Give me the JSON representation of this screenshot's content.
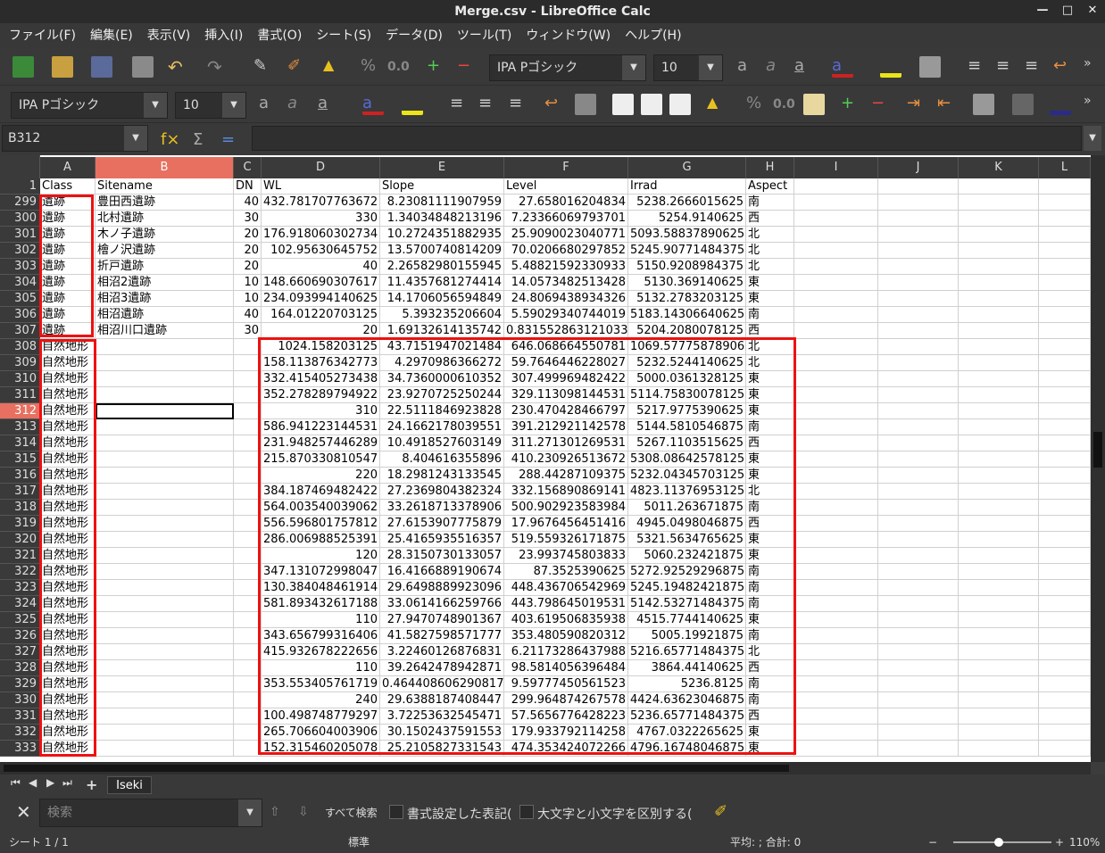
{
  "window": {
    "title": "Merge.csv - LibreOffice Calc"
  },
  "menu": [
    "ファイル(F)",
    "編集(E)",
    "表示(V)",
    "挿入(I)",
    "書式(O)",
    "シート(S)",
    "データ(D)",
    "ツール(T)",
    "ウィンドウ(W)",
    "ヘルプ(H)"
  ],
  "toolbar1": {
    "font_name": "IPA Pゴシック",
    "font_size": "10",
    "num_format": "0.0"
  },
  "toolbar2": {
    "font_name": "IPA Pゴシック",
    "font_size": "10",
    "num_format": "0.0"
  },
  "formula": {
    "cell_ref": "B312",
    "content": ""
  },
  "sheet": {
    "columns": [
      "A",
      "B",
      "C",
      "D",
      "E",
      "F",
      "G",
      "H",
      "I",
      "J",
      "K",
      "L"
    ],
    "header_row": {
      "row": "1",
      "cells": [
        "Class",
        "Sitename",
        "DN",
        "WL",
        "Slope",
        "Level",
        "Irrad",
        "Aspect"
      ]
    },
    "rows": [
      {
        "n": "299",
        "cells": [
          "遺跡",
          "豊田西遺跡",
          "40",
          "432.781707763672",
          "8.23081111907959",
          "27.658016204834",
          "5238.2666015625",
          "南"
        ]
      },
      {
        "n": "300",
        "cells": [
          "遺跡",
          "北村遺跡",
          "30",
          "330",
          "1.34034848213196",
          "7.23366069793701",
          "5254.9140625",
          "西"
        ]
      },
      {
        "n": "301",
        "cells": [
          "遺跡",
          "木ノ子遺跡",
          "20",
          "176.918060302734",
          "10.2724351882935",
          "25.9090023040771",
          "5093.58837890625",
          "北"
        ]
      },
      {
        "n": "302",
        "cells": [
          "遺跡",
          "檜ノ沢遺跡",
          "20",
          "102.95630645752",
          "13.5700740814209",
          "70.0206680297852",
          "5245.90771484375",
          "北"
        ]
      },
      {
        "n": "303",
        "cells": [
          "遺跡",
          "折戸遺跡",
          "20",
          "40",
          "2.26582980155945",
          "5.48821592330933",
          "5150.9208984375",
          "北"
        ]
      },
      {
        "n": "304",
        "cells": [
          "遺跡",
          "相沼2遺跡",
          "10",
          "148.660690307617",
          "11.4357681274414",
          "14.0573482513428",
          "5130.369140625",
          "東"
        ]
      },
      {
        "n": "305",
        "cells": [
          "遺跡",
          "相沼3遺跡",
          "10",
          "234.093994140625",
          "14.1706056594849",
          "24.8069438934326",
          "5132.2783203125",
          "東"
        ]
      },
      {
        "n": "306",
        "cells": [
          "遺跡",
          "相沼遺跡",
          "40",
          "164.01220703125",
          "5.393235206604",
          "5.59029340744019",
          "5183.14306640625",
          "南"
        ]
      },
      {
        "n": "307",
        "cells": [
          "遺跡",
          "相沼川口遺跡",
          "30",
          "20",
          "1.69132614135742",
          "0.831552863121033",
          "5204.2080078125",
          "西"
        ]
      },
      {
        "n": "308",
        "cells": [
          "自然地形",
          "",
          "",
          "1024.158203125",
          "43.7151947021484",
          "646.068664550781",
          "1069.57775878906",
          "北"
        ]
      },
      {
        "n": "309",
        "cells": [
          "自然地形",
          "",
          "",
          "158.113876342773",
          "4.2970986366272",
          "59.7646446228027",
          "5232.5244140625",
          "北"
        ]
      },
      {
        "n": "310",
        "cells": [
          "自然地形",
          "",
          "",
          "332.415405273438",
          "34.7360000610352",
          "307.499969482422",
          "5000.0361328125",
          "東"
        ]
      },
      {
        "n": "311",
        "cells": [
          "自然地形",
          "",
          "",
          "352.278289794922",
          "23.9270725250244",
          "329.113098144531",
          "5114.75830078125",
          "東"
        ]
      },
      {
        "n": "312",
        "cells": [
          "自然地形",
          "",
          "",
          "310",
          "22.5111846923828",
          "230.470428466797",
          "5217.9775390625",
          "東"
        ]
      },
      {
        "n": "313",
        "cells": [
          "自然地形",
          "",
          "",
          "586.941223144531",
          "24.1662178039551",
          "391.212921142578",
          "5144.5810546875",
          "南"
        ]
      },
      {
        "n": "314",
        "cells": [
          "自然地形",
          "",
          "",
          "231.948257446289",
          "10.4918527603149",
          "311.271301269531",
          "5267.1103515625",
          "西"
        ]
      },
      {
        "n": "315",
        "cells": [
          "自然地形",
          "",
          "",
          "215.870330810547",
          "8.404616355896",
          "410.230926513672",
          "5308.08642578125",
          "東"
        ]
      },
      {
        "n": "316",
        "cells": [
          "自然地形",
          "",
          "",
          "220",
          "18.2981243133545",
          "288.44287109375",
          "5232.04345703125",
          "東"
        ]
      },
      {
        "n": "317",
        "cells": [
          "自然地形",
          "",
          "",
          "384.187469482422",
          "27.2369804382324",
          "332.156890869141",
          "4823.11376953125",
          "北"
        ]
      },
      {
        "n": "318",
        "cells": [
          "自然地形",
          "",
          "",
          "564.003540039062",
          "33.2618713378906",
          "500.902923583984",
          "5011.263671875",
          "南"
        ]
      },
      {
        "n": "319",
        "cells": [
          "自然地形",
          "",
          "",
          "556.596801757812",
          "27.6153907775879",
          "17.9676456451416",
          "4945.0498046875",
          "西"
        ]
      },
      {
        "n": "320",
        "cells": [
          "自然地形",
          "",
          "",
          "286.006988525391",
          "25.4165935516357",
          "519.559326171875",
          "5321.5634765625",
          "東"
        ]
      },
      {
        "n": "321",
        "cells": [
          "自然地形",
          "",
          "",
          "120",
          "28.3150730133057",
          "23.993745803833",
          "5060.232421875",
          "東"
        ]
      },
      {
        "n": "322",
        "cells": [
          "自然地形",
          "",
          "",
          "347.131072998047",
          "16.4166889190674",
          "87.3525390625",
          "5272.92529296875",
          "南"
        ]
      },
      {
        "n": "323",
        "cells": [
          "自然地形",
          "",
          "",
          "130.384048461914",
          "29.6498889923096",
          "448.436706542969",
          "5245.19482421875",
          "南"
        ]
      },
      {
        "n": "324",
        "cells": [
          "自然地形",
          "",
          "",
          "581.893432617188",
          "33.0614166259766",
          "443.798645019531",
          "5142.53271484375",
          "南"
        ]
      },
      {
        "n": "325",
        "cells": [
          "自然地形",
          "",
          "",
          "110",
          "27.9470748901367",
          "403.619506835938",
          "4515.7744140625",
          "東"
        ]
      },
      {
        "n": "326",
        "cells": [
          "自然地形",
          "",
          "",
          "343.656799316406",
          "41.5827598571777",
          "353.480590820312",
          "5005.19921875",
          "南"
        ]
      },
      {
        "n": "327",
        "cells": [
          "自然地形",
          "",
          "",
          "415.932678222656",
          "3.22460126876831",
          "6.21173286437988",
          "5216.65771484375",
          "北"
        ]
      },
      {
        "n": "328",
        "cells": [
          "自然地形",
          "",
          "",
          "110",
          "39.2642478942871",
          "98.5814056396484",
          "3864.44140625",
          "西"
        ]
      },
      {
        "n": "329",
        "cells": [
          "自然地形",
          "",
          "",
          "353.553405761719",
          "0.464408606290817",
          "9.59777450561523",
          "5236.8125",
          "南"
        ]
      },
      {
        "n": "330",
        "cells": [
          "自然地形",
          "",
          "",
          "240",
          "29.6388187408447",
          "299.964874267578",
          "4424.63623046875",
          "南"
        ]
      },
      {
        "n": "331",
        "cells": [
          "自然地形",
          "",
          "",
          "100.498748779297",
          "3.72253632545471",
          "57.5656776428223",
          "5236.65771484375",
          "西"
        ]
      },
      {
        "n": "332",
        "cells": [
          "自然地形",
          "",
          "",
          "265.706604003906",
          "30.1502437591553",
          "179.933792114258",
          "4767.0322265625",
          "東"
        ]
      },
      {
        "n": "333",
        "cells": [
          "自然地形",
          "",
          "",
          "152.315460205078",
          "25.2105827331543",
          "474.353424072266",
          "4796.16748046875",
          "東"
        ]
      }
    ]
  },
  "tabs": {
    "sheet_name": "Iseki"
  },
  "find": {
    "placeholder": "検索",
    "find_all": "すべて検索",
    "formatted": "書式設定した表記(",
    "match_case": "大文字と小文字を区別する("
  },
  "status": {
    "sheet": "シート 1 / 1",
    "style": "標準",
    "sum": "平均: ; 合計: 0",
    "zoom": "110%"
  }
}
